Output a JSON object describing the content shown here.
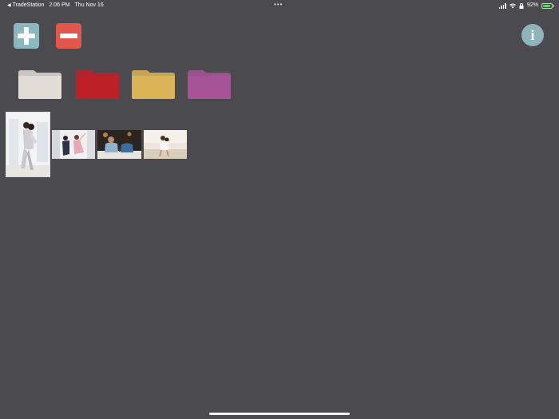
{
  "status_bar": {
    "back_app": "TradeStation",
    "time": "2:06 PM",
    "date": "Thu Nov 16",
    "dots": "•••",
    "battery_percent": "92%",
    "battery_level": 0.92
  },
  "toolbar": {
    "add_icon": "plus-icon",
    "remove_icon": "minus-icon",
    "info_label": "i"
  },
  "folders": [
    {
      "name": "folder-beige",
      "color": "#e2dcd7"
    },
    {
      "name": "folder-red",
      "color": "#be2028"
    },
    {
      "name": "folder-yellow",
      "color": "#dbb457"
    },
    {
      "name": "folder-purple",
      "color": "#a65497"
    }
  ],
  "photos": [
    {
      "name": "photo-couple-window",
      "orientation": "portrait"
    },
    {
      "name": "photo-couple-dancing",
      "orientation": "landscape"
    },
    {
      "name": "photo-couple-restaurant",
      "orientation": "landscape"
    },
    {
      "name": "photo-couple-beach",
      "orientation": "landscape"
    }
  ]
}
